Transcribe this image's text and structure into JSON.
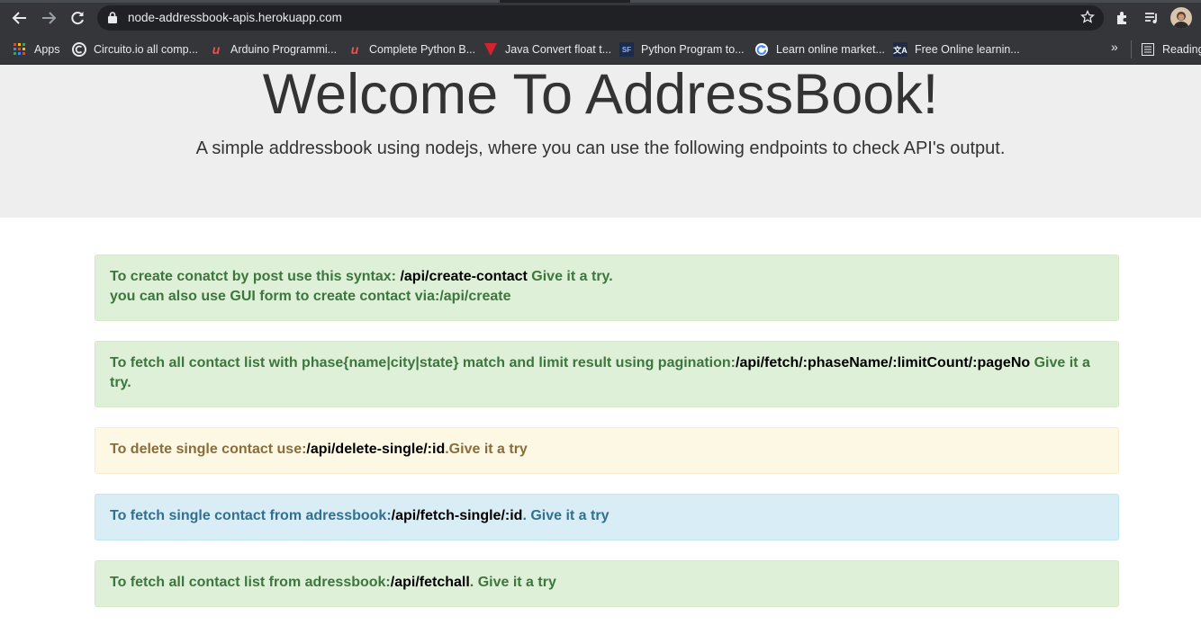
{
  "browser": {
    "url": "node-addressbook-apis.herokuapp.com",
    "bookmarks": [
      {
        "label": "Apps",
        "icon": "apps-grid-icon"
      },
      {
        "label": "Circuito.io all comp...",
        "icon": "circuito-icon"
      },
      {
        "label": "Arduino Programmi...",
        "icon": "udemy-icon"
      },
      {
        "label": "Complete Python B...",
        "icon": "udemy-icon"
      },
      {
        "label": "Java Convert float t...",
        "icon": "javatpoint-icon"
      },
      {
        "label": "Python Program to...",
        "icon": "sf-icon"
      },
      {
        "label": "Learn online market...",
        "icon": "google-icon"
      },
      {
        "label": "Free Online learnin...",
        "icon": "translate-icon"
      }
    ],
    "more": "»",
    "reading_list": "Reading"
  },
  "hero": {
    "title": "Welcome To AddressBook!",
    "subtitle": "A simple addressbook using nodejs, where you can use the following endpoints to check API's output."
  },
  "alerts": {
    "create": {
      "pre": "To create conatct by post use this syntax: ",
      "endpoint": "/api/create-contact",
      "try": " Give it a try.",
      "line2": "you can also use GUI form to create contact via:/api/create"
    },
    "fetch_phase": {
      "pre": "To fetch all contact list with phase{name|city|state} match and limit result using pagination:",
      "endpoint": "/api/fetch/:phaseName/:limitCount/:pageNo",
      "try": " Give it a try."
    },
    "delete": {
      "pre": "To delete single contact use:",
      "endpoint": "/api/delete-single/:id",
      "try": ".Give it a try"
    },
    "fetch_single": {
      "pre": "To fetch single contact from adressbook:",
      "endpoint": "/api/fetch-single/:id",
      "try": ". Give it a try"
    },
    "fetch_all": {
      "pre": "To fetch all contact list from adressbook:",
      "endpoint": "/api/fetchall",
      "try": ". Give it a try"
    }
  },
  "colors": {
    "success_bg": "#dff0d8",
    "success_text": "#3c763d",
    "warning_bg": "#fcf8e3",
    "warning_text": "#8a6d3b",
    "info_bg": "#d9edf7",
    "info_text": "#31708f",
    "jumbotron_bg": "#eeeeee"
  }
}
